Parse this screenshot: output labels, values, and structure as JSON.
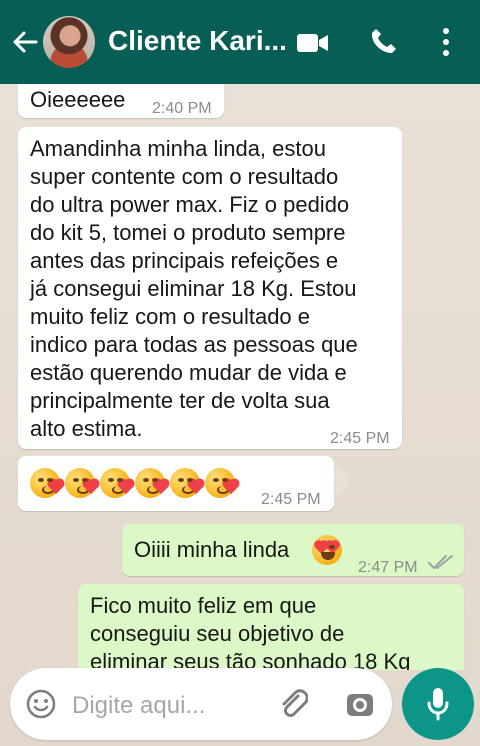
{
  "header": {
    "title": "Cliente Kari...",
    "icons": {
      "back": "back-arrow-icon",
      "avatar": "contact-avatar",
      "video": "video-call-icon",
      "call": "phone-call-icon",
      "menu": "more-options-icon"
    }
  },
  "messages": [
    {
      "direction": "incoming",
      "text": "Oieeeeee",
      "time": "2:40 PM"
    },
    {
      "direction": "incoming",
      "text": "Amandinha minha linda, estou\nsuper contente com o resultado\ndo ultra power max. Fiz o pedido\ndo kit 5, tomei o produto sempre\nantes das principais refeições e\njá consegui eliminar 18 Kg. Estou\nmuito feliz com o resultado e\nindico para todas as pessoas que\nestão querendo mudar de vida e\nprincipalmente ter de volta sua\nalto estima.",
      "time": "2:45 PM"
    },
    {
      "direction": "incoming",
      "emoji_count": 6,
      "emoji": "kissing-face-with-heart",
      "time": "2:45 PM"
    },
    {
      "direction": "outgoing",
      "text": "Oiiii minha linda",
      "emoji": "heart-eyes-face",
      "time": "2:47 PM",
      "status": "read-receipt-icon"
    },
    {
      "direction": "outgoing",
      "text": "Fico muito feliz em que\nconseguiu seu objetivo de\neliminar seus tão sonhado 18 Kg"
    }
  ],
  "composer": {
    "placeholder": "Digite aqui...",
    "icons": {
      "emoji": "emoji-icon",
      "attach": "paperclip-icon",
      "camera": "camera-icon",
      "mic": "microphone-icon"
    }
  },
  "colors": {
    "header": "#075e54",
    "incoming_bubble": "#ffffff",
    "outgoing_bubble": "#dcf8c6",
    "accent": "#0c9688"
  }
}
